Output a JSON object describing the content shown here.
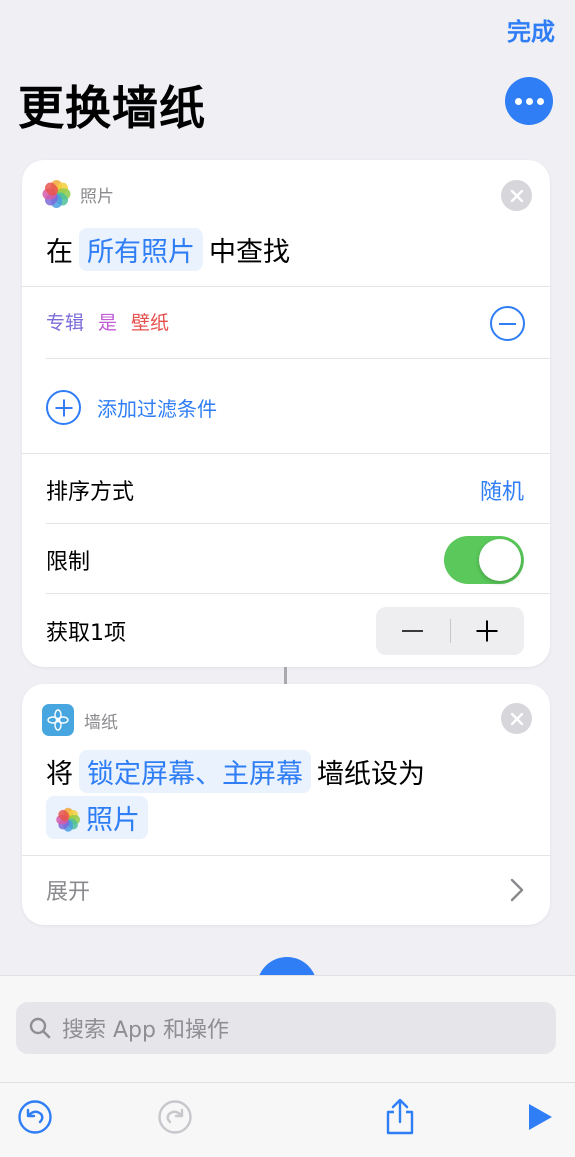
{
  "header": {
    "done_label": "完成",
    "title": "更换墙纸",
    "more_icon": "ellipsis-circle-icon"
  },
  "photos_action": {
    "app_label": "照片",
    "prefix": "在",
    "source_token": "所有照片",
    "suffix": "中查找",
    "filter": {
      "field": "专辑",
      "operator": "是",
      "value": "壁纸"
    },
    "add_filter_label": "添加过滤条件",
    "sort_label": "排序方式",
    "sort_value": "随机",
    "limit_label": "限制",
    "limit_enabled": true,
    "get_label": "获取1项"
  },
  "wallpaper_action": {
    "app_label": "墙纸",
    "prefix": "将",
    "screens_token": "锁定屏幕、主屏幕",
    "suffix": "墙纸设为",
    "photo_token": "照片",
    "expand_label": "展开"
  },
  "search": {
    "placeholder": "搜索 App 和操作"
  },
  "colors": {
    "accent": "#2f7ef6",
    "toggle_on": "#5ac85a",
    "background": "#efeff4"
  }
}
